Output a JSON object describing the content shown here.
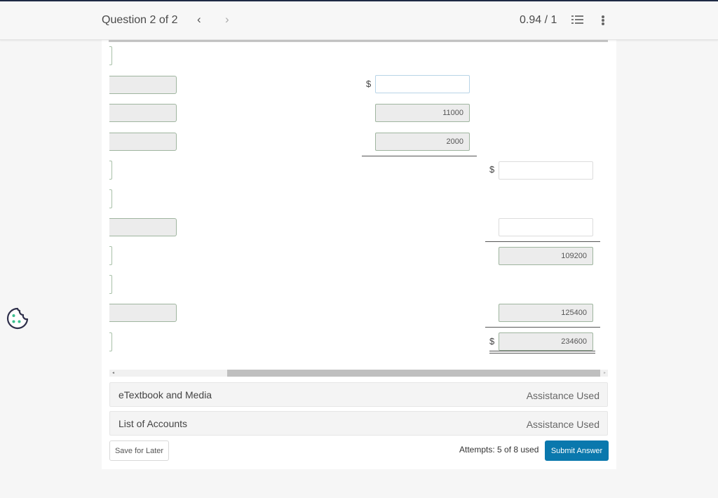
{
  "header": {
    "question_label": "Question 2 of 2",
    "prev_icon": "chevron-left-icon",
    "prev_glyph": "‹",
    "next_icon": "chevron-right-icon",
    "next_glyph": "›",
    "score": "0.94 / 1",
    "list_icon": "numbered-list-icon",
    "more_icon": "more-vertical-icon"
  },
  "worksheet": {
    "currency_symbol": "$",
    "column2": {
      "row1_value": "",
      "row2_value": "11000",
      "row3_value": "2000"
    },
    "column3": {
      "row1_value": "",
      "row2_value": "",
      "row3_value": "109200",
      "row4_value": "125400",
      "total_value": "234600"
    }
  },
  "scrollbar": {
    "left_arrow": "◂",
    "right_arrow": "▸"
  },
  "resources": [
    {
      "label": "eTextbook and Media",
      "status": "Assistance Used"
    },
    {
      "label": "List of Accounts",
      "status": "Assistance Used"
    }
  ],
  "footer": {
    "save_label": "Save for Later",
    "attempts": "Attempts: 5 of 8 used",
    "submit_label": "Submit Answer"
  },
  "colors": {
    "submit_bg": "#0a78ad",
    "top_line": "#1f2a44",
    "cookie_dots": "#3bbf8f"
  }
}
